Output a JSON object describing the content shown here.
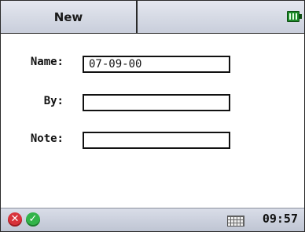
{
  "title": "New",
  "form": {
    "name_label": "Name:",
    "name_value": "07-09-00",
    "by_label": "By:",
    "by_value": "",
    "note_label": "Note:",
    "note_value": ""
  },
  "status": {
    "time": "09:57"
  },
  "icons": {
    "battery": "battery-icon",
    "cancel": "cancel-icon",
    "ok": "ok-icon",
    "keyboard": "keyboard-icon"
  },
  "colors": {
    "cancel": "#d8323a",
    "ok": "#33b44a",
    "battery": "#1f8a2a"
  }
}
